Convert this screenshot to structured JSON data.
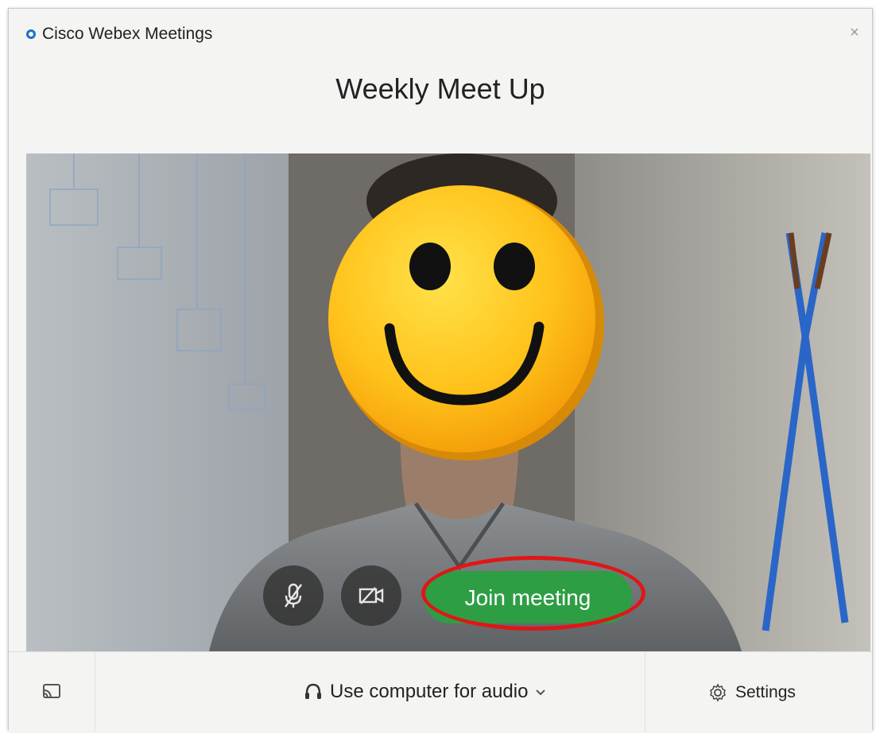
{
  "window": {
    "app_name": "Cisco Webex Meetings",
    "close_glyph": "×"
  },
  "meeting": {
    "title": "Weekly Meet Up"
  },
  "controls": {
    "mute_icon": "microphone-off-icon",
    "video_icon": "video-off-icon",
    "join_label": "Join meeting"
  },
  "bottom_bar": {
    "cast_icon": "screen-cast-icon",
    "audio_label": "Use computer for audio",
    "audio_icon": "headset-icon",
    "audio_dropdown_icon": "chevron-down-icon",
    "settings_label": "Settings",
    "settings_icon": "gear-icon"
  },
  "colors": {
    "join_button": "#2e9e45",
    "highlight_ring": "#e01616",
    "app_logo": "#1d71c6",
    "emoji_face": "#ffc21a"
  }
}
